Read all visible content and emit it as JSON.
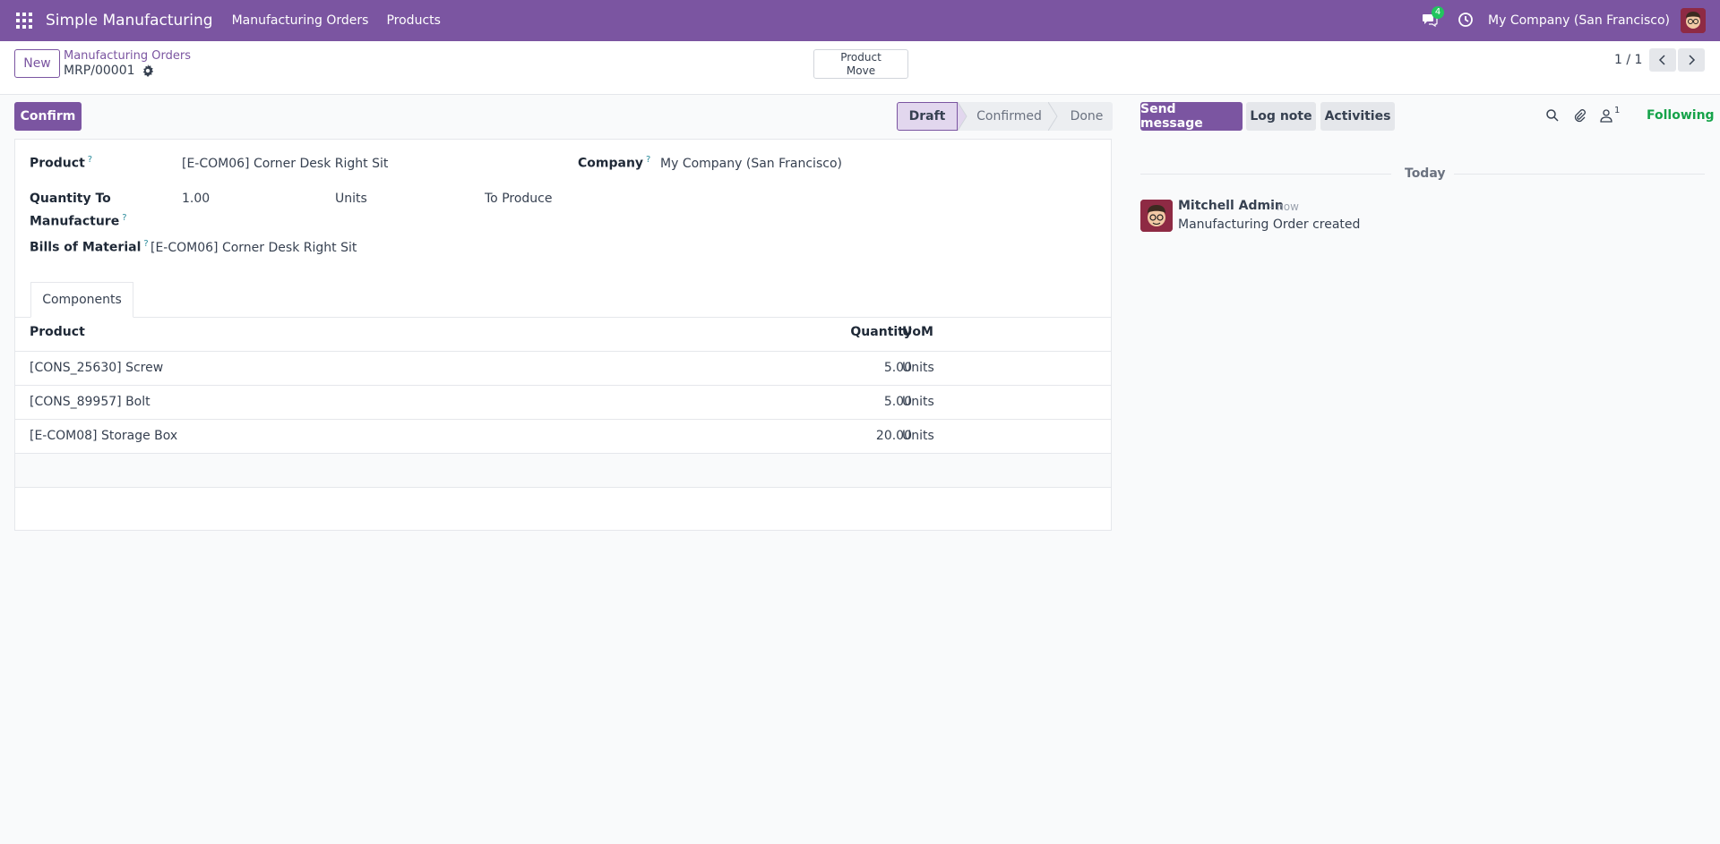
{
  "navbar": {
    "app_name": "Simple Manufacturing",
    "menu": [
      "Manufacturing Orders",
      "Products"
    ],
    "messages_count": "4",
    "company": "My Company (San Francisco)",
    "color": "#7b55a1"
  },
  "control_panel": {
    "new_label": "New",
    "breadcrumb": "Manufacturing Orders",
    "record_name": "MRP/00001",
    "smart_button": {
      "line1": "Product",
      "line2": "Move"
    },
    "pager": "1 / 1"
  },
  "form": {
    "confirm_label": "Confirm",
    "stages": [
      "Draft",
      "Confirmed",
      "Done"
    ],
    "active_stage": "Draft",
    "fields": {
      "product_label": "Product",
      "product_value": "[E-COM06] Corner Desk Right Sit",
      "company_label": "Company",
      "company_value": "My Company (San Francisco)",
      "qty_label_line1": "Quantity To",
      "qty_label_line2": "Manufacture",
      "qty_value": "1.00",
      "qty_uom": "Units",
      "qty_suffix": "To Produce",
      "bom_label": "Bills of Material",
      "bom_value": "[E-COM06] Corner Desk Right Sit",
      "help_mark": "?"
    },
    "tab_label": "Components",
    "table": {
      "headers": {
        "product": "Product",
        "quantity": "Quantity",
        "uom": "UoM"
      },
      "rows": [
        {
          "product": "[CONS_25630] Screw",
          "quantity": "5.00",
          "uom": "Units"
        },
        {
          "product": "[CONS_89957] Bolt",
          "quantity": "5.00",
          "uom": "Units"
        },
        {
          "product": "[E-COM08] Storage Box",
          "quantity": "20.00",
          "uom": "Units"
        }
      ]
    }
  },
  "chatter": {
    "send_message": "Send message",
    "log_note": "Log note",
    "activities": "Activities",
    "followers_count": "1",
    "following": "Following",
    "date_separator": "Today",
    "message": {
      "author": "Mitchell Admin",
      "date": "- now",
      "body": "Manufacturing Order created"
    }
  }
}
